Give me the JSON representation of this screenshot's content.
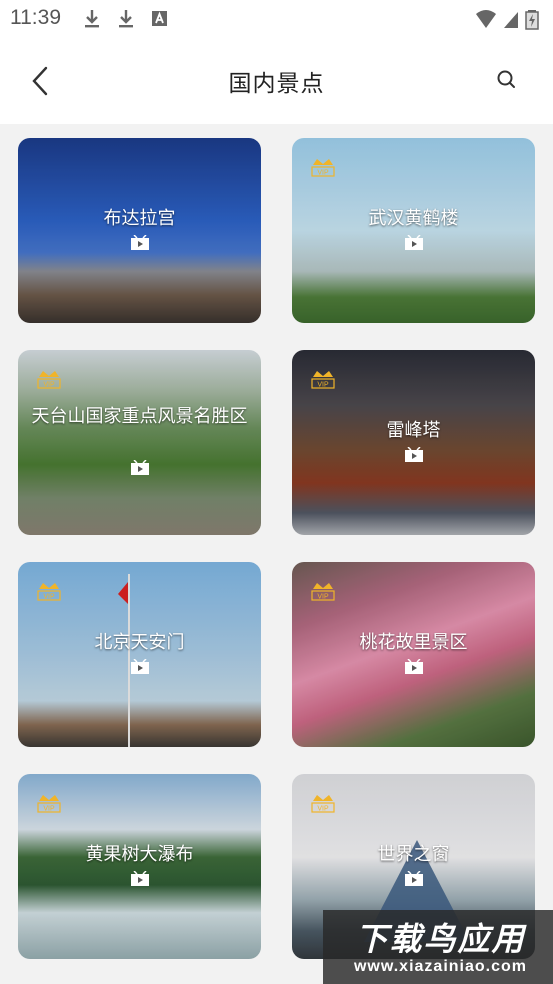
{
  "status_bar": {
    "time": "11:39",
    "left_icons": [
      "download-icon",
      "download-icon",
      "font-a-icon"
    ],
    "right_icons": [
      "wifi-icon",
      "signal-icon",
      "battery-charging-icon"
    ]
  },
  "header": {
    "title": "国内景点",
    "back_icon": "chevron-left-icon",
    "search_icon": "search-icon"
  },
  "vip_label": "VIP",
  "cards": [
    {
      "title": "布达拉宫",
      "vip": false
    },
    {
      "title": "武汉黄鹤楼",
      "vip": true
    },
    {
      "title": "天台山国家重点风景名胜区",
      "vip": true
    },
    {
      "title": "雷峰塔",
      "vip": true
    },
    {
      "title": "北京天安门",
      "vip": true
    },
    {
      "title": "桃花故里景区",
      "vip": true
    },
    {
      "title": "黄果树大瀑布",
      "vip": true
    },
    {
      "title": "世界之窗",
      "vip": true
    }
  ],
  "watermark": {
    "main": "下载鸟应用",
    "url": "www.xiazainiao.com"
  },
  "colors": {
    "header_bg": "#ffffff",
    "page_bg": "#f2f2f2",
    "vip_gold": "#f0b429",
    "title_text": "#222222"
  }
}
